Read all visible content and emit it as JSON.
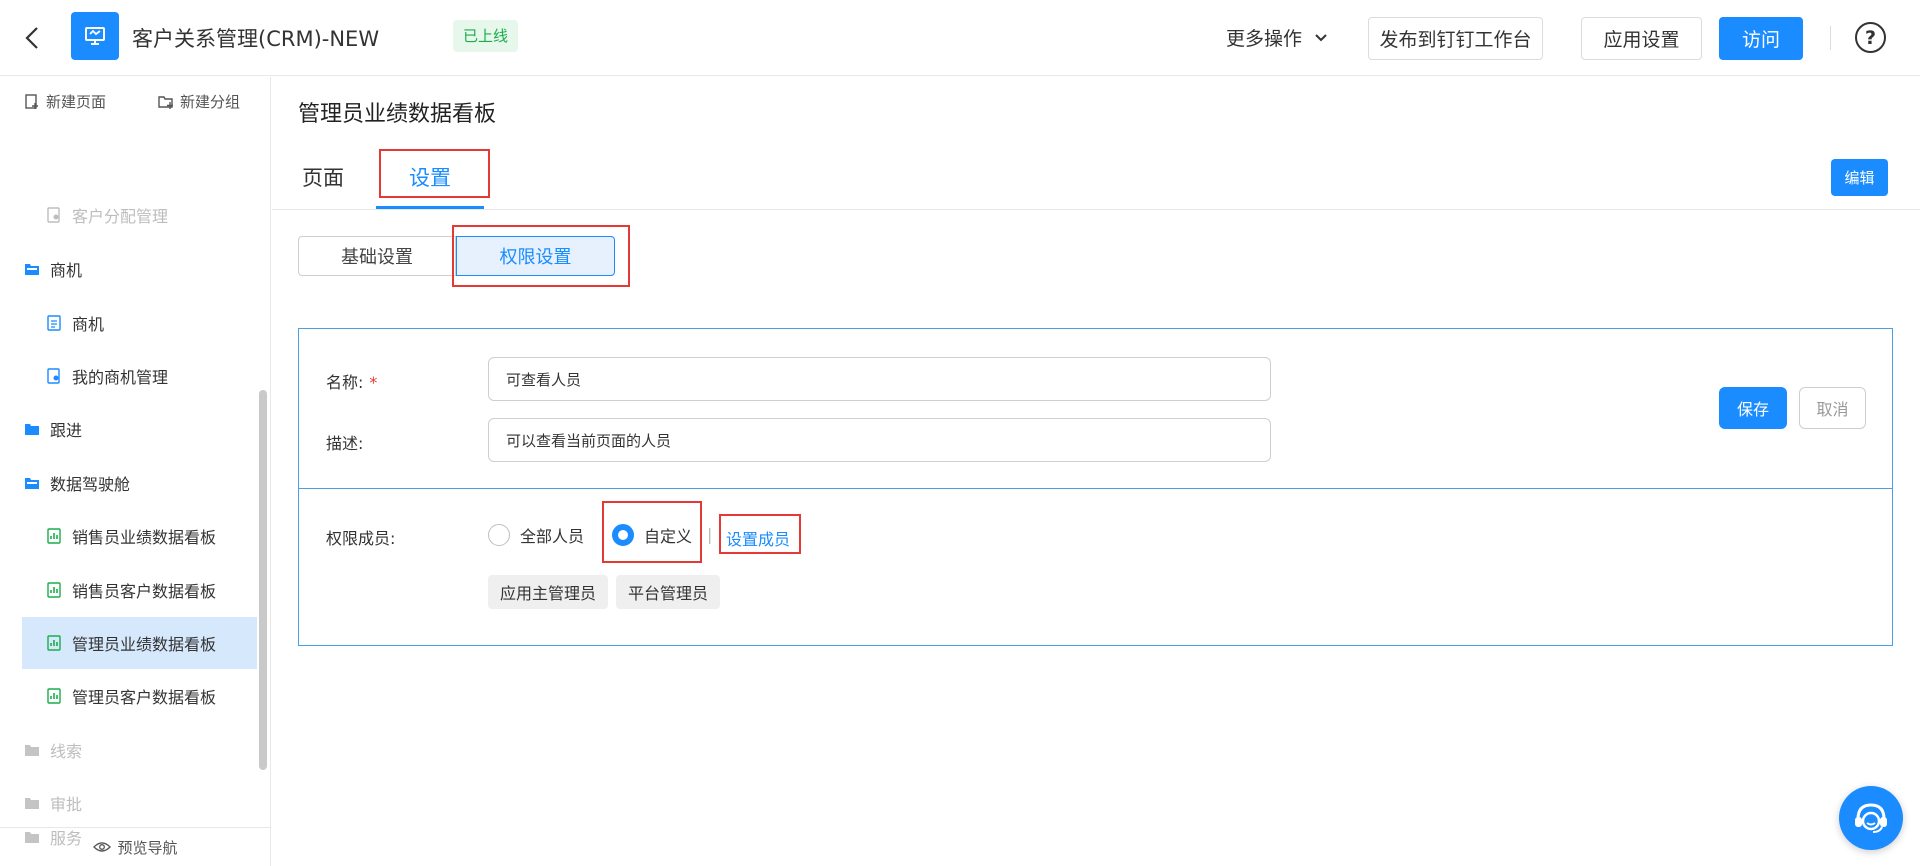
{
  "header": {
    "app_title": "客户关系管理(CRM)-NEW",
    "status": "已上线",
    "more_actions": "更多操作",
    "publish": "发布到钉钉工作台",
    "app_settings": "应用设置",
    "visit": "访问"
  },
  "sidebar": {
    "new_page": "新建页面",
    "new_group": "新建分组",
    "items": [
      {
        "label": "客户分配管理"
      },
      {
        "label": "商机"
      },
      {
        "label": "商机"
      },
      {
        "label": "我的商机管理"
      },
      {
        "label": "跟进"
      },
      {
        "label": "数据驾驶舱"
      },
      {
        "label": "销售员业绩数据看板"
      },
      {
        "label": "销售员客户数据看板"
      },
      {
        "label": "管理员业绩数据看板"
      },
      {
        "label": "管理员客户数据看板"
      },
      {
        "label": "线索"
      },
      {
        "label": "审批"
      },
      {
        "label": "服务"
      }
    ],
    "preview_nav": "预览导航"
  },
  "main": {
    "title": "管理员业绩数据看板",
    "tabs": [
      {
        "label": "页面"
      },
      {
        "label": "设置"
      }
    ],
    "edit": "编辑",
    "segments": [
      {
        "label": "基础设置"
      },
      {
        "label": "权限设置"
      }
    ],
    "form": {
      "name_label": "名称:",
      "required_mark": "*",
      "name_value": "可查看人员",
      "desc_label": "描述:",
      "desc_value": "可以查看当前页面的人员",
      "save": "保存",
      "cancel": "取消",
      "members_label": "权限成员:",
      "option_all": "全部人员",
      "option_custom": "自定义",
      "separator": "|",
      "set_members": "设置成员",
      "tags": [
        {
          "label": "应用主管理员"
        },
        {
          "label": "平台管理员"
        }
      ]
    }
  },
  "colors": {
    "accent": "#1a8cff",
    "highlight": "#e53935",
    "online_green": "#1aad4b"
  }
}
